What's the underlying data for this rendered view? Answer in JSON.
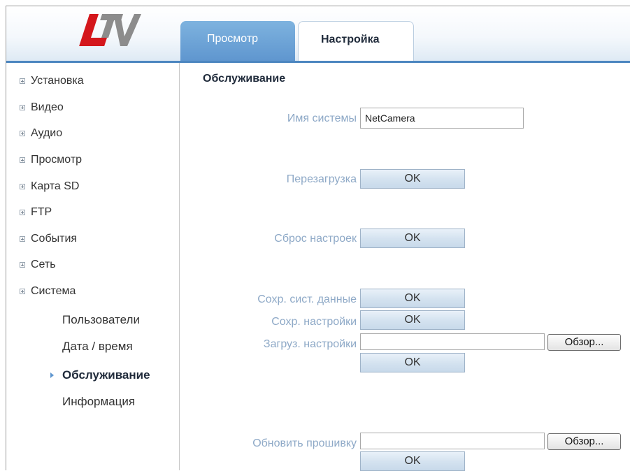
{
  "tabs": {
    "view": "Просмотр",
    "settings": "Настройка"
  },
  "sidebar": {
    "items": [
      "Установка",
      "Видео",
      "Аудио",
      "Просмотр",
      "Карта SD",
      "FTP",
      "События",
      "Сеть",
      "Система"
    ],
    "system_subitems": [
      "Пользователи",
      "Дата / время",
      "Обслуживание",
      "Информация"
    ],
    "active_subitem": "Обслуживание"
  },
  "main": {
    "title": "Обслуживание",
    "system_name_label": "Имя системы",
    "system_name_value": "NetCamera",
    "reboot_label": "Перезагрузка",
    "reset_label": "Сброс настроек",
    "save_sys_data_label": "Сохр. сист. данные",
    "save_settings_label": "Сохр. настройки",
    "load_settings_label": "Загруз. настройки",
    "update_firmware_label": "Обновить прошивку",
    "ok_label": "OK",
    "browse_label": "Обзор..."
  },
  "colors": {
    "accent": "#4c86c0",
    "tab_inactive": "#6ea5d8",
    "label": "#8ea9c7",
    "logo_red": "#d4171c",
    "logo_gray": "#8c8c8c"
  }
}
